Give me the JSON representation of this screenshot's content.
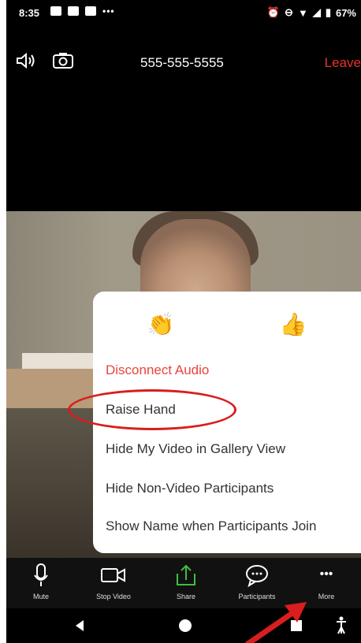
{
  "status": {
    "time": "8:35",
    "battery": "67%"
  },
  "header": {
    "phone_number": "555-555-5555",
    "leave_label": "Leave"
  },
  "reactions": {
    "clap_emoji": "👏",
    "thumbs_emoji": "👍"
  },
  "menu": {
    "items": [
      {
        "label": "Disconnect Audio"
      },
      {
        "label": "Raise Hand"
      },
      {
        "label": "Hide My Video in Gallery View"
      },
      {
        "label": "Hide Non-Video Participants"
      },
      {
        "label": "Show Name when Participants Join"
      }
    ]
  },
  "toolbar": {
    "mute_label": "Mute",
    "stop_video_label": "Stop Video",
    "share_label": "Share",
    "participants_label": "Participants",
    "more_label": "More",
    "more_glyph": "•••"
  },
  "colors": {
    "leave": "#e8332f",
    "disconnect": "#e8453c",
    "share_green": "#3fbf3f",
    "annotation_red": "#d81e1e"
  }
}
